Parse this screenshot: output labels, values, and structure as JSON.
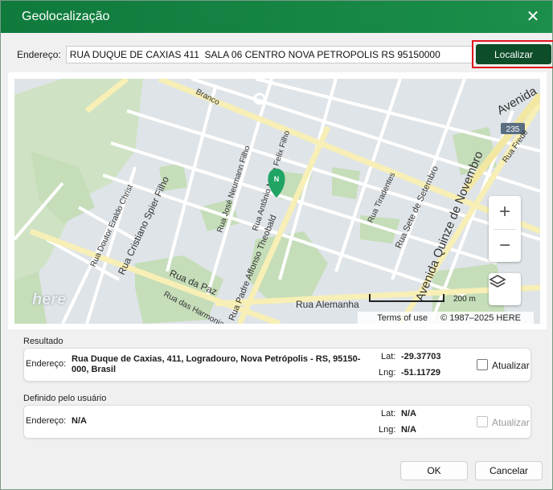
{
  "window": {
    "title": "Geolocalização",
    "close_glyph": "✕"
  },
  "search": {
    "label": "Endereço:",
    "value": "RUA DUQUE DE CAXIAS 411  SALA 06 CENTRO NOVA PETROPOLIS RS 95150000",
    "button": "Localizar"
  },
  "map": {
    "marker_letter": "N",
    "street_labels": [
      "Avenida",
      "Rua Fredé",
      "Rua José Neumann Filho",
      "Rua Antônio Maria Felix Filho",
      "Rua Padre Affonso Theobald",
      "Rua Tiradentes",
      "Rua Sete de Setembro",
      "Avenida Quinze de Novembro",
      "Rua Cristiano Spier Filho",
      "Rua Doutor Eraldo Christ",
      "Rua da Paz",
      "Rua das Harmonia",
      "Rua Alemanha",
      "Branco"
    ],
    "route_badge": "235",
    "zoom_in": "+",
    "zoom_out": "−",
    "scale_label": "200 m",
    "logo": "here",
    "terms": "Terms of use",
    "copyright": "© 1987–2025 HERE"
  },
  "result": {
    "section_title": "Resultado",
    "address_label": "Endereço:",
    "address_value": "Rua Duque de Caxias, 411, Logradouro, Nova Petrópolis - RS, 95150-000, Brasil",
    "lat_label": "Lat:",
    "lat_value": "-29.37703",
    "lng_label": "Lng:",
    "lng_value": "-51.11729",
    "update_label": "Atualizar"
  },
  "user_defined": {
    "section_title": "Definido pelo usuário",
    "address_label": "Endereço:",
    "address_value": "N/A",
    "lat_label": "Lat:",
    "lat_value": "N/A",
    "lng_label": "Lng:",
    "lng_value": "N/A",
    "update_label": "Atualizar"
  },
  "footer": {
    "ok": "OK",
    "cancel": "Cancelar"
  },
  "colors": {
    "titlebar": "#1b8f4b",
    "primary_button": "#0e4d2a",
    "highlight": "#e0141e",
    "marker": "#1fa463"
  }
}
